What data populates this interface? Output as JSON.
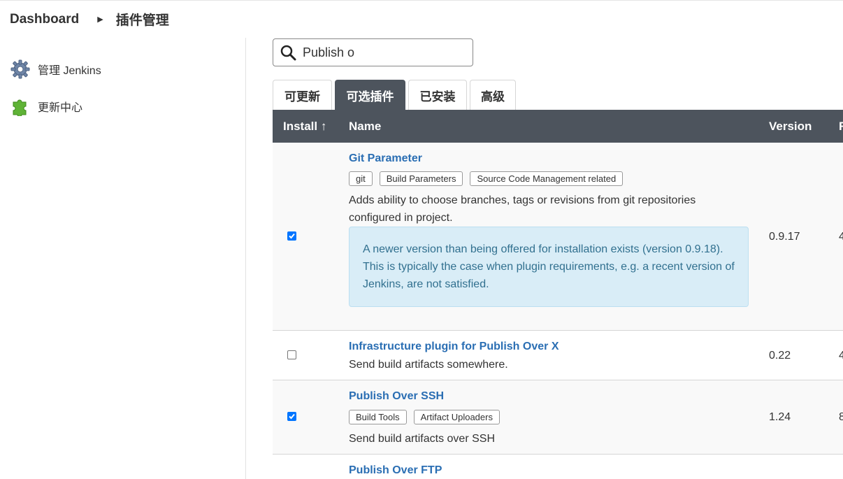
{
  "breadcrumb": {
    "home": "Dashboard",
    "current": "插件管理"
  },
  "sidebar": {
    "items": [
      {
        "label": "管理 Jenkins",
        "icon": "gear-icon"
      },
      {
        "label": "更新中心",
        "icon": "puzzle-icon"
      }
    ]
  },
  "search": {
    "value": "Publish o",
    "icon": "search-icon"
  },
  "tabs": [
    {
      "label": "可更新",
      "active": false
    },
    {
      "label": "可选插件",
      "active": true
    },
    {
      "label": "已安装",
      "active": false
    },
    {
      "label": "高级",
      "active": false
    }
  ],
  "table": {
    "headers": {
      "install": "Install ↑",
      "name": "Name",
      "version": "Version",
      "extra": "R"
    },
    "rows": [
      {
        "checked": true,
        "name": "Git Parameter",
        "tags": [
          "git",
          "Build Parameters",
          "Source Code Management related"
        ],
        "description": "Adds ability to choose branches, tags or revisions from git repositories configured in project.",
        "notice": "A newer version than being offered for installation exists (version 0.9.18). This is typically the case when plugin requirements, e.g. a recent version of Jenkins, are not satisfied.",
        "version": "0.9.17",
        "extra": "4"
      },
      {
        "checked": false,
        "name": "Infrastructure plugin for Publish Over X",
        "tags": [],
        "description": "Send build artifacts somewhere.",
        "version": "0.22",
        "extra": "4"
      },
      {
        "checked": true,
        "name": "Publish Over SSH",
        "tags": [
          "Build Tools",
          "Artifact Uploaders"
        ],
        "description": "Send build artifacts over SSH",
        "version": "1.24",
        "extra": "8"
      },
      {
        "checked": false,
        "name": "Publish Over FTP"
      }
    ]
  },
  "colors": {
    "header_bg": "#4d545d",
    "link": "#2a6eb3",
    "checkbox": "#0075ff",
    "notice_bg": "#d9edf7",
    "notice_text": "#31708f"
  }
}
